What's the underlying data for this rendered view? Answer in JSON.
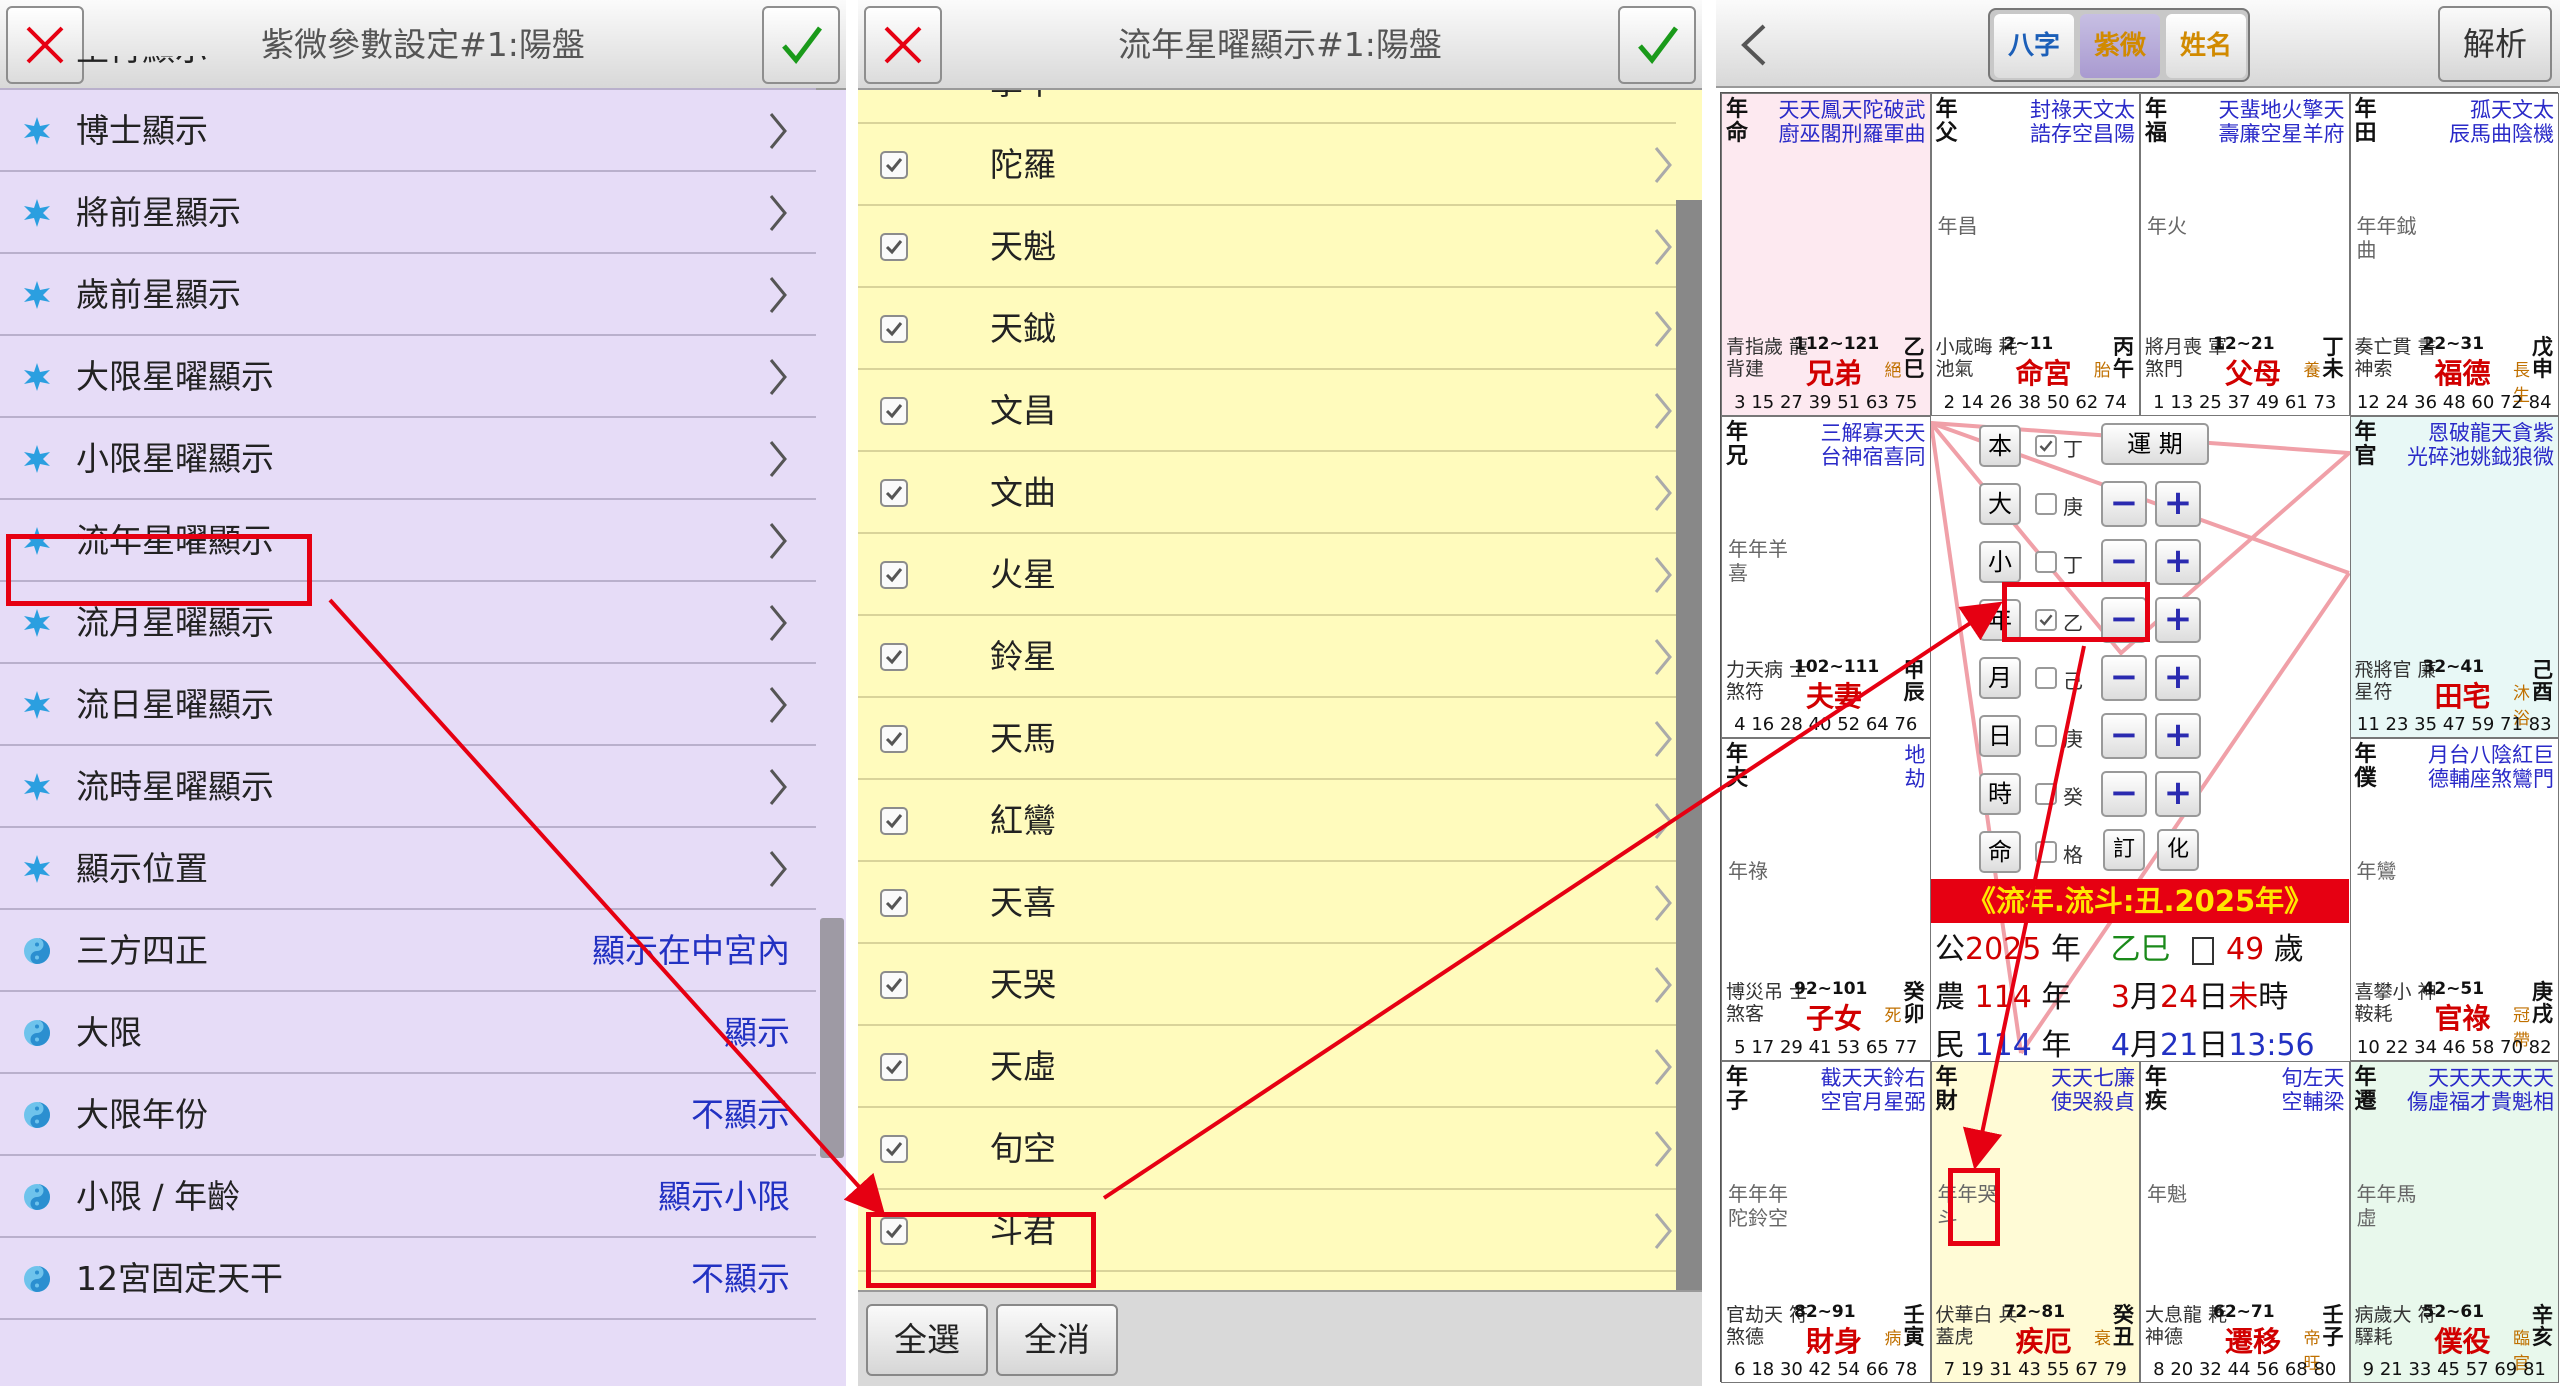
{
  "panel1": {
    "title": "紫微參數設定#1:陽盤",
    "partial_top_label": "生肖顯示",
    "items": [
      {
        "label": "博士顯示",
        "icon": "star-burst-icon"
      },
      {
        "label": "將前星顯示",
        "icon": "star-burst-icon"
      },
      {
        "label": "歲前星顯示",
        "icon": "star-burst-icon"
      },
      {
        "label": "大限星曜顯示",
        "icon": "star-burst-icon"
      },
      {
        "label": "小限星曜顯示",
        "icon": "star-burst-icon"
      },
      {
        "label": "流年星曜顯示",
        "icon": "star-burst-icon"
      },
      {
        "label": "流月星曜顯示",
        "icon": "star-burst-icon"
      },
      {
        "label": "流日星曜顯示",
        "icon": "star-burst-icon"
      },
      {
        "label": "流時星曜顯示",
        "icon": "star-burst-icon"
      },
      {
        "label": "顯示位置",
        "icon": "star-burst-icon"
      }
    ],
    "settings": [
      {
        "label": "三方四正",
        "value": "顯示在中宮內",
        "icon": "yin-yang-icon"
      },
      {
        "label": "大限",
        "value": "顯示",
        "icon": "yin-yang-icon"
      },
      {
        "label": "大限年份",
        "value": "不顯示",
        "icon": "yin-yang-icon"
      },
      {
        "label": "小限 / 年齡",
        "value": "顯示小限",
        "icon": "yin-yang-icon"
      },
      {
        "label": "12宮固定天干",
        "value": "不顯示",
        "icon": "yin-yang-icon"
      }
    ]
  },
  "panel2": {
    "title": "流年星曜顯示#1:陽盤",
    "partial_top_label": "擎羊",
    "items": [
      "陀羅",
      "天魁",
      "天鉞",
      "文昌",
      "文曲",
      "火星",
      "鈴星",
      "天馬",
      "紅鸞",
      "天喜",
      "天哭",
      "天虛",
      "旬空",
      "斗君"
    ],
    "select_all": "全選",
    "clear_all": "全消"
  },
  "panel3": {
    "segments": [
      "八字",
      "紫微",
      "姓名"
    ],
    "selected_segment": "紫微",
    "analysis_button": "解析",
    "cells": [
      {
        "name": "年命",
        "stars": "天天鳳天陀破武",
        "stars2": "廚巫閣刑羅軍曲",
        "mid": "",
        "pal": "兄弟",
        "range": "112~121",
        "stem": "乙巳",
        "left": "青指歲 龍背建",
        "right": "絕",
        "nums": "3 15 27 39 51 63 75"
      },
      {
        "name": "年父",
        "stars": "封祿天文太",
        "stars2": "誥存空昌陽",
        "mid": "年昌",
        "pal": "命宮",
        "range": "2~11",
        "stem": "丙午",
        "left": "小咸晦 耗池氣",
        "right": "胎",
        "nums": "2 14 26 38 50 62 74"
      },
      {
        "name": "年福",
        "stars": "天蜚地火擎天",
        "stars2": "壽廉空星羊府",
        "mid": "年火",
        "pal": "父母",
        "range": "12~21",
        "stem": "丁未",
        "left": "將月喪 軍煞門",
        "right": "養",
        "nums": "1 13 25 37 49 61 73"
      },
      {
        "name": "年田",
        "stars": "孤天文太",
        "stars2": "辰馬曲陰機",
        "mid": "年年鉞曲",
        "pal": "福德",
        "range": "22~31",
        "stem": "戊申",
        "left": "奏亡貫 書神索",
        "right": "長生",
        "nums": "12 24 36 48 60 72 84"
      },
      {
        "name": "年兄",
        "stars": "三解寡天天",
        "stars2": "台神宿喜同",
        "mid": "年年羊喜",
        "pal": "夫妻",
        "range": "102~111",
        "stem": "甲辰",
        "left": "力天病 士煞符",
        "right": "",
        "nums": "4 16 28 40 52 64 76"
      },
      {
        "name": "年官",
        "stars": "恩破龍天貪紫",
        "stars2": "光碎池姚鉞狼微",
        "mid": "",
        "pal": "田宅",
        "range": "32~41",
        "stem": "己酉",
        "left": "飛將官 廉星符",
        "right": "沐浴",
        "nums": "11 23 35 47 59 71 83"
      },
      {
        "name": "年夫",
        "stars": "地",
        "stars2": "劫",
        "mid": "年祿",
        "pal": "子女",
        "range": "92~101",
        "stem": "癸卯",
        "left": "博災吊 士煞客",
        "right": "死",
        "nums": "5 17 29 41 53 65 77"
      },
      {
        "name": "年僕",
        "stars": "月台八陰紅巨",
        "stars2": "德輔座煞鸞門",
        "mid": "年鸞",
        "pal": "官祿",
        "range": "42~51",
        "stem": "庚戌",
        "left": "喜攀小 神鞍耗",
        "right": "冠帶",
        "nums": "10 22 34 46 58 70 82"
      },
      {
        "name": "年子",
        "stars": "截天天鈴右",
        "stars2": "空官月星弼",
        "mid": "年年年陀鈴空",
        "pal": "財身",
        "range": "82~91",
        "stem": "壬寅",
        "left": "官劫天 符煞德",
        "right": "病",
        "nums": "6 18 30 42 54 66 78"
      },
      {
        "name": "年財",
        "stars": "天天七廉",
        "stars2": "使哭殺貞",
        "mid": "年年哭斗",
        "pal": "疾厄",
        "range": "72~81",
        "stem": "癸丑",
        "left": "伏華白 兵蓋虎",
        "right": "衰",
        "nums": "7 19 31 43 55 67 79"
      },
      {
        "name": "年疾",
        "stars": "旬左天",
        "stars2": "空輔梁",
        "mid": "年魁",
        "pal": "遷移",
        "range": "62~71",
        "stem": "壬子",
        "left": "大息龍 耗神德",
        "right": "帝旺",
        "nums": "8 20 32 44 56 68 80"
      },
      {
        "name": "年遷",
        "stars": "天天天天天天",
        "stars2": "傷虛福才貴魁相",
        "mid": "年年馬虛",
        "pal": "僕役",
        "range": "52~61",
        "stem": "辛亥",
        "left": "病歲大 符驛耗",
        "right": "臨官",
        "nums": "9 21 33 45 57 69 81"
      }
    ],
    "center": {
      "rows": [
        {
          "btn": "本",
          "checked": true,
          "stem": "丁",
          "extra": "運 期"
        },
        {
          "btn": "大",
          "checked": false,
          "stem": "庚"
        },
        {
          "btn": "小",
          "checked": false,
          "stem": "丁"
        },
        {
          "btn": "年",
          "checked": true,
          "stem": "乙"
        },
        {
          "btn": "月",
          "checked": false,
          "stem": "己"
        },
        {
          "btn": "日",
          "checked": false,
          "stem": "庚"
        },
        {
          "btn": "時",
          "checked": false,
          "stem": "癸"
        },
        {
          "btn": "命",
          "checked": false,
          "stem": "格"
        }
      ],
      "ding": "訂",
      "hua": "化",
      "banner": "《流年.流斗:丑.2025年》",
      "line1": {
        "a": "公",
        "year": "2025",
        "b": "年",
        "gz": "乙巳",
        "age": "49",
        "c": "歲"
      },
      "line2": {
        "a": "農",
        "year": "114",
        "b": "年",
        "m": "3",
        "mm": "月",
        "d": "24",
        "dd": "日",
        "h": "未",
        "hh": "時"
      },
      "line3": {
        "a": "民",
        "year": "114",
        "b": "年",
        "m": "4",
        "mm": "月",
        "d": "21",
        "dd": "日",
        "t": "13:56"
      }
    }
  },
  "colors": {
    "red": "#e60012",
    "purple_bg": "#e6dcf7",
    "yellow_bg": "#fffbbd",
    "blue_text": "#2231c2"
  }
}
